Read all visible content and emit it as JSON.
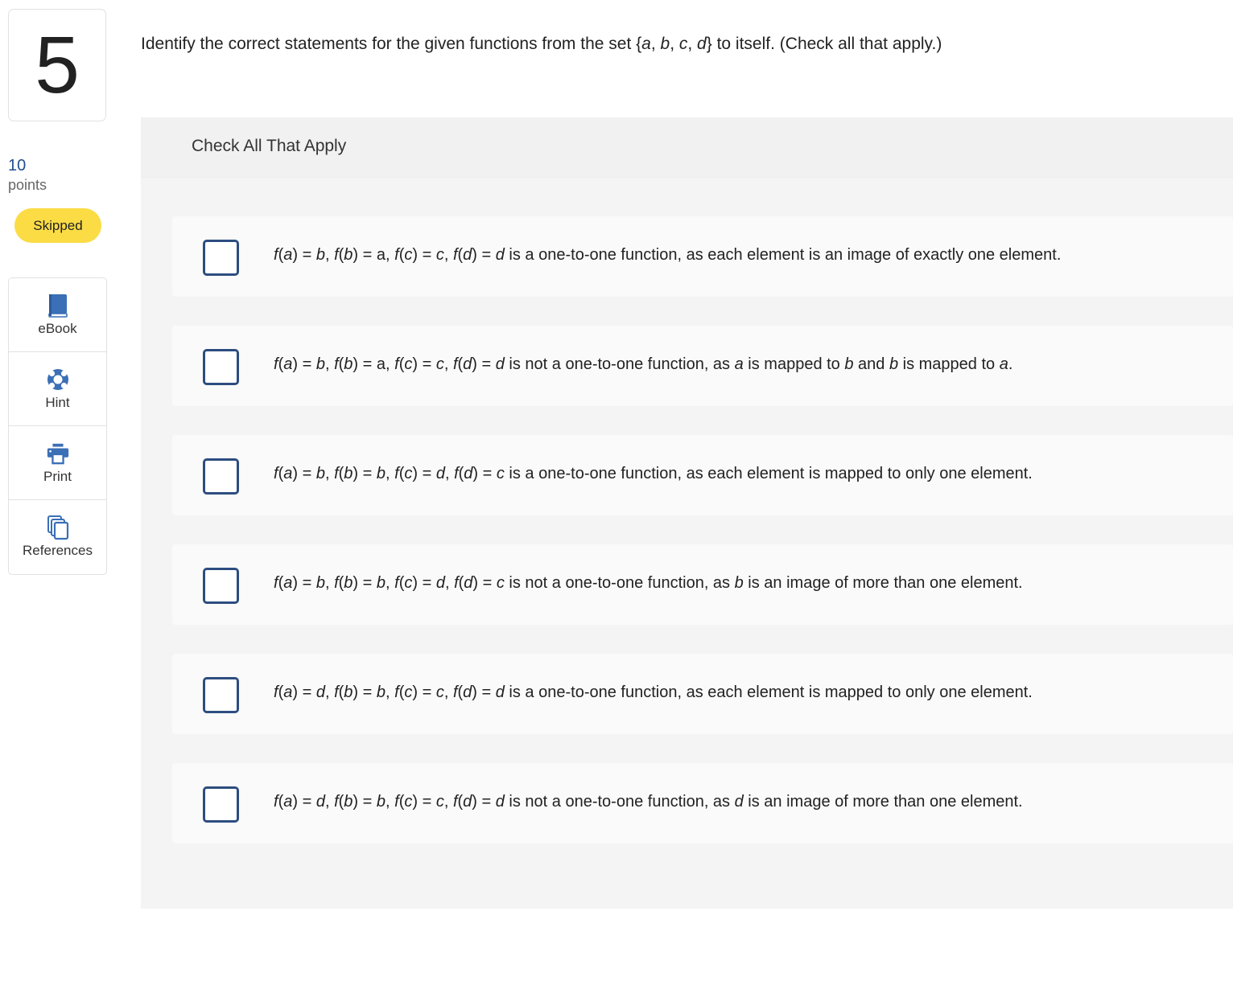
{
  "question": {
    "number": "5",
    "points_value": "10",
    "points_label": "points",
    "status": "Skipped",
    "prompt": {
      "before": "Identify the correct statements for the given functions from the set {",
      "set_a": "a",
      "comma1": ", ",
      "set_b": "b",
      "comma2": ", ",
      "set_c": "c",
      "comma3": ", ",
      "set_d": "d",
      "after": "} to itself. (Check all that apply.)"
    }
  },
  "tools": [
    {
      "label": "eBook",
      "icon": "book-icon"
    },
    {
      "label": "Hint",
      "icon": "lifebuoy-icon"
    },
    {
      "label": "Print",
      "icon": "printer-icon"
    },
    {
      "label": "References",
      "icon": "copy-documents-icon"
    }
  ],
  "panel": {
    "title": "Check All That Apply"
  },
  "options": [
    {
      "checked": false,
      "parts": [
        {
          "t": "f",
          "i": true
        },
        {
          "t": "(",
          "i": false
        },
        {
          "t": "a",
          "i": true
        },
        {
          "t": ") = ",
          "i": false
        },
        {
          "t": "b",
          "i": true
        },
        {
          "t": ", ",
          "i": false
        },
        {
          "t": "f",
          "i": true
        },
        {
          "t": "(",
          "i": false
        },
        {
          "t": "b",
          "i": true
        },
        {
          "t": ") = a, ",
          "i": false
        },
        {
          "t": "f",
          "i": true
        },
        {
          "t": "(",
          "i": false
        },
        {
          "t": "c",
          "i": true
        },
        {
          "t": ") = ",
          "i": false
        },
        {
          "t": "c",
          "i": true
        },
        {
          "t": ", ",
          "i": false
        },
        {
          "t": "f",
          "i": true
        },
        {
          "t": "(",
          "i": false
        },
        {
          "t": "d",
          "i": true
        },
        {
          "t": ") = ",
          "i": false
        },
        {
          "t": "d",
          "i": true
        },
        {
          "t": " is a one-to-one function, as each element is an image of exactly one element.",
          "i": false
        }
      ]
    },
    {
      "checked": false,
      "parts": [
        {
          "t": "f",
          "i": true
        },
        {
          "t": "(",
          "i": false
        },
        {
          "t": "a",
          "i": true
        },
        {
          "t": ") = ",
          "i": false
        },
        {
          "t": "b",
          "i": true
        },
        {
          "t": ", ",
          "i": false
        },
        {
          "t": "f",
          "i": true
        },
        {
          "t": "(",
          "i": false
        },
        {
          "t": "b",
          "i": true
        },
        {
          "t": ") = a, ",
          "i": false
        },
        {
          "t": "f",
          "i": true
        },
        {
          "t": "(",
          "i": false
        },
        {
          "t": "c",
          "i": true
        },
        {
          "t": ") = ",
          "i": false
        },
        {
          "t": "c",
          "i": true
        },
        {
          "t": ", ",
          "i": false
        },
        {
          "t": "f",
          "i": true
        },
        {
          "t": "(",
          "i": false
        },
        {
          "t": "d",
          "i": true
        },
        {
          "t": ") = ",
          "i": false
        },
        {
          "t": "d",
          "i": true
        },
        {
          "t": " is not a one-to-one function, as ",
          "i": false
        },
        {
          "t": "a",
          "i": true
        },
        {
          "t": " is mapped to ",
          "i": false
        },
        {
          "t": "b",
          "i": true
        },
        {
          "t": " and ",
          "i": false
        },
        {
          "t": "b",
          "i": true
        },
        {
          "t": " is mapped to ",
          "i": false
        },
        {
          "t": "a",
          "i": true
        },
        {
          "t": ".",
          "i": false
        }
      ]
    },
    {
      "checked": false,
      "parts": [
        {
          "t": "f",
          "i": true
        },
        {
          "t": "(",
          "i": false
        },
        {
          "t": "a",
          "i": true
        },
        {
          "t": ") = ",
          "i": false
        },
        {
          "t": "b",
          "i": true
        },
        {
          "t": ", ",
          "i": false
        },
        {
          "t": "f",
          "i": true
        },
        {
          "t": "(",
          "i": false
        },
        {
          "t": "b",
          "i": true
        },
        {
          "t": ") = ",
          "i": false
        },
        {
          "t": "b",
          "i": true
        },
        {
          "t": ", ",
          "i": false
        },
        {
          "t": "f",
          "i": true
        },
        {
          "t": "(",
          "i": false
        },
        {
          "t": "c",
          "i": true
        },
        {
          "t": ") = ",
          "i": false
        },
        {
          "t": "d",
          "i": true
        },
        {
          "t": ", ",
          "i": false
        },
        {
          "t": "f",
          "i": true
        },
        {
          "t": "(",
          "i": false
        },
        {
          "t": "d",
          "i": true
        },
        {
          "t": ") = ",
          "i": false
        },
        {
          "t": "c",
          "i": true
        },
        {
          "t": " is a one-to-one function, as each element is mapped to only one element.",
          "i": false
        }
      ]
    },
    {
      "checked": false,
      "parts": [
        {
          "t": "f",
          "i": true
        },
        {
          "t": "(",
          "i": false
        },
        {
          "t": "a",
          "i": true
        },
        {
          "t": ") = ",
          "i": false
        },
        {
          "t": "b",
          "i": true
        },
        {
          "t": ", ",
          "i": false
        },
        {
          "t": "f",
          "i": true
        },
        {
          "t": "(",
          "i": false
        },
        {
          "t": "b",
          "i": true
        },
        {
          "t": ") = ",
          "i": false
        },
        {
          "t": "b",
          "i": true
        },
        {
          "t": ", ",
          "i": false
        },
        {
          "t": "f",
          "i": true
        },
        {
          "t": "(",
          "i": false
        },
        {
          "t": "c",
          "i": true
        },
        {
          "t": ") = ",
          "i": false
        },
        {
          "t": "d",
          "i": true
        },
        {
          "t": ", ",
          "i": false
        },
        {
          "t": "f",
          "i": true
        },
        {
          "t": "(",
          "i": false
        },
        {
          "t": "d",
          "i": true
        },
        {
          "t": ") = ",
          "i": false
        },
        {
          "t": "c",
          "i": true
        },
        {
          "t": " is not a one-to-one function, as ",
          "i": false
        },
        {
          "t": "b",
          "i": true
        },
        {
          "t": " is an image of more than one element.",
          "i": false
        }
      ]
    },
    {
      "checked": false,
      "parts": [
        {
          "t": "f",
          "i": true
        },
        {
          "t": "(",
          "i": false
        },
        {
          "t": "a",
          "i": true
        },
        {
          "t": ") = ",
          "i": false
        },
        {
          "t": "d",
          "i": true
        },
        {
          "t": ", ",
          "i": false
        },
        {
          "t": "f",
          "i": true
        },
        {
          "t": "(",
          "i": false
        },
        {
          "t": "b",
          "i": true
        },
        {
          "t": ") = ",
          "i": false
        },
        {
          "t": "b",
          "i": true
        },
        {
          "t": ", ",
          "i": false
        },
        {
          "t": "f",
          "i": true
        },
        {
          "t": "(",
          "i": false
        },
        {
          "t": "c",
          "i": true
        },
        {
          "t": ") = ",
          "i": false
        },
        {
          "t": "c",
          "i": true
        },
        {
          "t": ", ",
          "i": false
        },
        {
          "t": "f",
          "i": true
        },
        {
          "t": "(",
          "i": false
        },
        {
          "t": "d",
          "i": true
        },
        {
          "t": ") = ",
          "i": false
        },
        {
          "t": "d",
          "i": true
        },
        {
          "t": " is a one-to-one function, as each element is mapped to only one element.",
          "i": false
        }
      ]
    },
    {
      "checked": false,
      "parts": [
        {
          "t": "f",
          "i": true
        },
        {
          "t": "(",
          "i": false
        },
        {
          "t": "a",
          "i": true
        },
        {
          "t": ") = ",
          "i": false
        },
        {
          "t": "d",
          "i": true
        },
        {
          "t": ", ",
          "i": false
        },
        {
          "t": "f",
          "i": true
        },
        {
          "t": "(",
          "i": false
        },
        {
          "t": "b",
          "i": true
        },
        {
          "t": ") = ",
          "i": false
        },
        {
          "t": "b",
          "i": true
        },
        {
          "t": ", ",
          "i": false
        },
        {
          "t": "f",
          "i": true
        },
        {
          "t": "(",
          "i": false
        },
        {
          "t": "c",
          "i": true
        },
        {
          "t": ") = ",
          "i": false
        },
        {
          "t": "c",
          "i": true
        },
        {
          "t": ", ",
          "i": false
        },
        {
          "t": "f",
          "i": true
        },
        {
          "t": "(",
          "i": false
        },
        {
          "t": "d",
          "i": true
        },
        {
          "t": ") = ",
          "i": false
        },
        {
          "t": "d",
          "i": true
        },
        {
          "t": " is not a one-to-one function, as ",
          "i": false
        },
        {
          "t": "d",
          "i": true
        },
        {
          "t": " is an image of more than one element.",
          "i": false
        }
      ]
    }
  ],
  "colors": {
    "accent": "#2d4d80",
    "icon_blue": "#3b6fb6",
    "badge": "#fbdc45",
    "points": "#1f4e8f"
  }
}
